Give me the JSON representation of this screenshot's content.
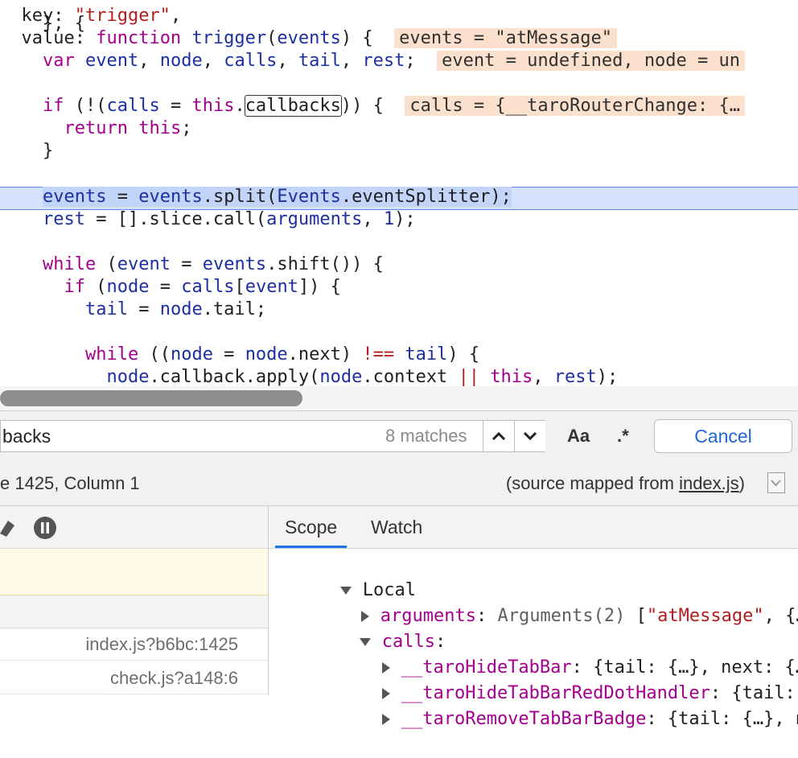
{
  "code": {
    "lines": [
      {
        "t": "}, {"
      },
      {
        "t": "  key: \"trigger\","
      },
      {
        "t": "  value: function trigger(events) {",
        "ann": "events = \"atMessage\""
      },
      {
        "t": "    var event, node, calls, tail, rest;",
        "ann": "event = undefined, node = un"
      },
      {
        "t": "    if (!(calls = this.callbacks)) {",
        "ann": "calls = {__taroRouterChange: {…"
      },
      {
        "t": "      return this;"
      },
      {
        "t": "    }"
      },
      {
        "t": "    events = events.split(Events.eventSplitter);"
      },
      {
        "t": "    rest = [].slice.call(arguments, 1);"
      },
      {
        "t": "    while (event = events.shift()) {"
      },
      {
        "t": "      if (node = calls[event]) {"
      },
      {
        "t": "        tail = node.tail;"
      },
      {
        "t": "        while ((node = node.next) !== tail) {"
      },
      {
        "t": "          node.callback.apply(node.context || this, rest);"
      },
      {
        "t": "        }"
      }
    ]
  },
  "search": {
    "value": "backs",
    "matches": "8 matches",
    "case_toggle": "Aa",
    "regex_toggle": ".*",
    "cancel_label": "Cancel"
  },
  "status": {
    "position": "e 1425, Column 1",
    "source_prefix": "(source mapped from ",
    "source_link": "index.js",
    "source_suffix": ")"
  },
  "callstack": {
    "frames": [
      {
        "loc": "index.js?b6bc:1425"
      },
      {
        "loc": "check.js?a148:6"
      }
    ]
  },
  "tabs": {
    "scope": "Scope",
    "watch": "Watch"
  },
  "scope": {
    "local_label": "Local",
    "arguments_key": "arguments",
    "arguments_type": "Arguments(2)",
    "arguments_bracket": " [",
    "arguments_str": "\"atMessage\"",
    "arguments_rest": ", {……",
    "calls_key": "calls",
    "items": [
      {
        "key": "__taroHideTabBar",
        "val": ": {tail: {…}, next: {……"
      },
      {
        "key": "__taroHideTabBarRedDotHandler",
        "val": ": {tail: …"
      },
      {
        "key": "__taroRemoveTabBarBadge",
        "val": ": {tail: {…}, n"
      }
    ]
  },
  "colors": {
    "keyword": "#a3008e",
    "string": "#b31d1d",
    "identifier": "#1c2fa0",
    "exec_line": "#d4e2fb",
    "annotation": "#fbe1cd",
    "accent": "#1a73e8"
  }
}
